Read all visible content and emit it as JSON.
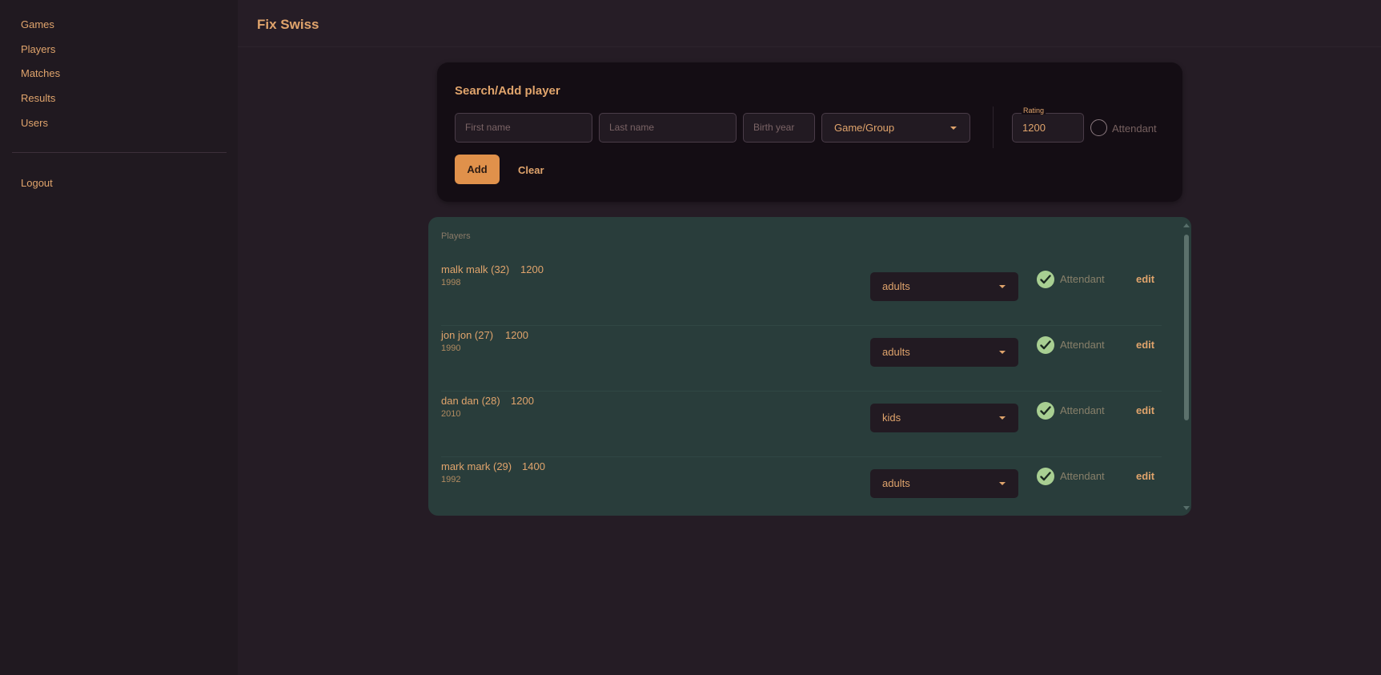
{
  "sidebar": {
    "items": [
      {
        "label": "Games"
      },
      {
        "label": "Players"
      },
      {
        "label": "Matches"
      },
      {
        "label": "Results"
      },
      {
        "label": "Users"
      }
    ],
    "logout_label": "Logout"
  },
  "header": {
    "title": "Fix Swiss"
  },
  "search_card": {
    "title": "Search/Add player",
    "first_name_placeholder": "First name",
    "last_name_placeholder": "Last name",
    "birth_year_placeholder": "Birth year",
    "group_select_value": "Game/Group",
    "rating_label": "Rating",
    "rating_value": "1200",
    "attendant_label": "Attendant",
    "attendant_checked": false,
    "add_label": "Add",
    "clear_label": "Clear"
  },
  "players": {
    "heading": "Players",
    "attendant_label": "Attendant",
    "edit_label": "edit",
    "rows": [
      {
        "name": "malk malk (32)",
        "rating": "1200",
        "year": "1998",
        "group": "adults",
        "attendant": true
      },
      {
        "name": "jon jon (27)",
        "rating": "1200",
        "year": "1990",
        "group": "adults",
        "attendant": true
      },
      {
        "name": "dan dan (28)",
        "rating": "1200",
        "year": "2010",
        "group": "kids",
        "attendant": true
      },
      {
        "name": "mark mark (29)",
        "rating": "1400",
        "year": "1992",
        "group": "adults",
        "attendant": true
      }
    ]
  },
  "colors": {
    "accent": "#e0a46c",
    "button": "#e0914b",
    "panel": "#293d3b",
    "check": "#a8cf92",
    "background": "#251c25"
  }
}
